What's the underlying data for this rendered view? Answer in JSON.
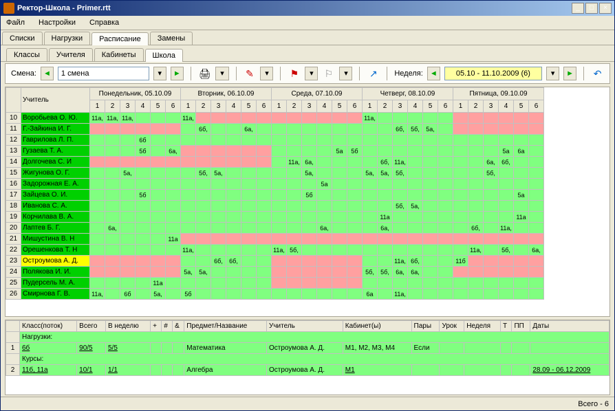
{
  "window": {
    "title": "Ректор-Школа - Primer.rtt"
  },
  "menu": [
    "Файл",
    "Настройки",
    "Справка"
  ],
  "tabs_main": [
    "Списки",
    "Нагрузки",
    "Расписание",
    "Замены"
  ],
  "tabs_main_active": 2,
  "tabs_sub": [
    "Классы",
    "Учителя",
    "Кабинеты",
    "Школа"
  ],
  "tabs_sub_active": 3,
  "toolbar": {
    "shift_label": "Смена:",
    "shift_value": "1 смена",
    "week_label": "Неделя:",
    "week_value": "05.10 - 11.10.2009  (6)"
  },
  "days": [
    "Понедельник, 05.10.09",
    "Вторник, 06.10.09",
    "Среда, 07.10.09",
    "Четверг, 08.10.09",
    "Пятница, 09.10.09"
  ],
  "periods": [
    "1",
    "2",
    "3",
    "4",
    "5",
    "6"
  ],
  "teacher_header": "Учитель",
  "rows": [
    {
      "n": "10",
      "name": "Воробьева О. Ю.",
      "tc": "teacher-grn",
      "cells": [
        "11а,",
        "11а,",
        "11а,",
        "",
        "",
        "",
        "11а,",
        "",
        "",
        "",
        "",
        "",
        "",
        "",
        "",
        "",
        "",
        "",
        "11а,",
        "",
        "",
        "",
        "",
        "",
        "",
        "",
        "",
        "",
        "",
        ""
      ]
    },
    {
      "n": "11",
      "name": "Г.-Зайкина И. Г.",
      "tc": "teacher-grn",
      "cells": [
        "",
        "",
        "",
        "",
        "",
        "",
        "",
        "6б,",
        "",
        "",
        "6а,",
        "",
        "",
        "",
        "",
        "",
        "",
        "",
        "",
        "",
        "6б,",
        "5б,",
        "5а,",
        "",
        "",
        "",
        "",
        "",
        "",
        ""
      ]
    },
    {
      "n": "12",
      "name": "Гаврилова Л. П.",
      "tc": "teacher-grn",
      "cells": [
        "",
        "",
        "",
        "6б",
        "",
        "",
        "",
        "",
        "",
        "",
        "",
        "",
        "",
        "",
        "",
        "",
        "",
        "",
        "",
        "",
        "",
        "",
        "",
        "",
        "",
        "",
        "",
        "",
        "",
        ""
      ]
    },
    {
      "n": "13",
      "name": "Гузаева Т. А.",
      "tc": "teacher-grn",
      "cells": [
        "",
        "",
        "",
        "5б",
        "",
        "6а,",
        "",
        "",
        "",
        "",
        "",
        "",
        "",
        "",
        "",
        "",
        "5а",
        "5б",
        "",
        "",
        "",
        "",
        "",
        "",
        "",
        "",
        "",
        "5а",
        "6а",
        ""
      ]
    },
    {
      "n": "14",
      "name": "Долгочева С. И",
      "tc": "teacher-grn",
      "cells": [
        "",
        "",
        "",
        "",
        "",
        "",
        "",
        "",
        "",
        "",
        "",
        "",
        "",
        "11а,",
        "6а,",
        "",
        "",
        "",
        "",
        "6б,",
        "11а,",
        "",
        "",
        "",
        "",
        "",
        "6а,",
        "6б,",
        "",
        ""
      ]
    },
    {
      "n": "15",
      "name": "Жигунова О. Г.",
      "tc": "teacher-grn",
      "cells": [
        "",
        "",
        "5а,",
        "",
        "",
        "",
        "",
        "5б,",
        "5а,",
        "",
        "",
        "",
        "",
        "",
        "5а,",
        "",
        "",
        "",
        "5а,",
        "5а,",
        "5б,",
        "",
        "",
        "",
        "",
        "",
        "5б,",
        "",
        "",
        ""
      ]
    },
    {
      "n": "16",
      "name": "Задорожная Е. А.",
      "tc": "teacher-grn",
      "cells": [
        "",
        "",
        "",
        "",
        "",
        "",
        "",
        "",
        "",
        "",
        "",
        "",
        "",
        "",
        "",
        "5а",
        "",
        "",
        "",
        "",
        "",
        "",
        "",
        "",
        "",
        "",
        "",
        "",
        "",
        ""
      ]
    },
    {
      "n": "17",
      "name": "Зайцева О. И.",
      "tc": "teacher-grn",
      "cells": [
        "",
        "",
        "",
        "5б",
        "",
        "",
        "",
        "",
        "",
        "",
        "",
        "",
        "",
        "",
        "5б",
        "",
        "",
        "",
        "",
        "",
        "",
        "",
        "",
        "",
        "",
        "",
        "",
        "",
        "5а",
        ""
      ]
    },
    {
      "n": "18",
      "name": "Иванова С. А.",
      "tc": "teacher-grn",
      "cells": [
        "",
        "",
        "",
        "",
        "",
        "",
        "",
        "",
        "",
        "",
        "",
        "",
        "",
        "",
        "",
        "",
        "",
        "",
        "",
        "",
        "5б,",
        "5а,",
        "",
        "",
        "",
        "",
        "",
        "",
        "",
        ""
      ]
    },
    {
      "n": "19",
      "name": "Корчилава В. А.",
      "tc": "teacher-grn",
      "cells": [
        "",
        "",
        "",
        "",
        "",
        "",
        "",
        "",
        "",
        "",
        "",
        "",
        "",
        "",
        "",
        "",
        "",
        "",
        "",
        "11а",
        "",
        "",
        "",
        "",
        "",
        "",
        "",
        "",
        "11а",
        ""
      ]
    },
    {
      "n": "20",
      "name": "Лаптев Б. Г.",
      "tc": "teacher-grn",
      "cells": [
        "",
        "6а,",
        "",
        "",
        "",
        "",
        "",
        "",
        "",
        "",
        "",
        "",
        "",
        "",
        "",
        "6а,",
        "",
        "",
        "",
        "6а,",
        "",
        "",
        "",
        "",
        "",
        "6б,",
        "",
        "11а,",
        "",
        ""
      ]
    },
    {
      "n": "21",
      "name": "Мишустина В. Н",
      "tc": "teacher-grn",
      "cells": [
        "",
        "",
        "",
        "",
        "",
        "11а",
        "",
        "",
        "",
        "",
        "",
        "",
        "",
        "",
        "",
        "",
        "",
        "",
        "",
        "",
        "",
        "",
        "",
        "",
        "",
        "",
        "",
        "",
        "",
        ""
      ]
    },
    {
      "n": "22",
      "name": "Орешенкова Т. Н",
      "tc": "teacher-grn",
      "cells": [
        "",
        "",
        "",
        "",
        "",
        "",
        "11а,",
        "",
        "",
        "",
        "",
        "",
        "11а,",
        "5б,",
        "",
        "",
        "",
        "",
        "",
        "",
        "",
        "",
        "",
        "",
        "",
        "11а,",
        "",
        "5б,",
        "",
        "6а,"
      ]
    },
    {
      "n": "23",
      "name": "Остроумова А. Д.",
      "tc": "teacher-yel",
      "cells": [
        "",
        "",
        "",
        "",
        "",
        "",
        "",
        "",
        "6б,",
        "6б,",
        "",
        "",
        "",
        "",
        "",
        "",
        "",
        "",
        "",
        "",
        "11а,",
        "6б,",
        "",
        "",
        "11б",
        "",
        "",
        "",
        "",
        ""
      ]
    },
    {
      "n": "24",
      "name": "Полякова И. И.",
      "tc": "teacher-grn",
      "cells": [
        "",
        "",
        "",
        "",
        "",
        "",
        "5а,",
        "5а,",
        "",
        "",
        "",
        "",
        "",
        "",
        "",
        "",
        "",
        "",
        "5б,",
        "5б,",
        "6а,",
        "6а,",
        "",
        "",
        "",
        "",
        "",
        "",
        "",
        ""
      ]
    },
    {
      "n": "25",
      "name": "Пудерсель М. А.",
      "tc": "teacher-grn",
      "cells": [
        "",
        "",
        "",
        "",
        "11а",
        "",
        "",
        "",
        "",
        "",
        "",
        "",
        "",
        "",
        "",
        "",
        "",
        "",
        "",
        "",
        "",
        "",
        "",
        "",
        "",
        "",
        "",
        "",
        "",
        ""
      ]
    },
    {
      "n": "26",
      "name": "Смирнова Г. В.",
      "tc": "teacher-grn",
      "cells": [
        "11а,",
        "",
        "6б",
        "",
        "5а,",
        "",
        "5б",
        "",
        "",
        "",
        "",
        "",
        "",
        "",
        "",
        "",
        "",
        "",
        "6а",
        "",
        "11а,",
        "",
        "",
        "",
        "",
        "",
        "",
        "",
        "",
        ""
      ]
    }
  ],
  "pink_map": {
    "10": [
      6,
      7,
      8,
      9,
      10,
      11,
      12,
      13,
      14,
      15,
      16,
      17,
      24,
      25,
      26,
      27,
      28,
      29
    ],
    "11": [
      0,
      1,
      2,
      3,
      4,
      5,
      24,
      25,
      26,
      27,
      28,
      29
    ],
    "13": [
      6,
      7,
      8,
      9,
      10,
      11
    ],
    "14": [
      0,
      1,
      2,
      3,
      4,
      5,
      6,
      7,
      8,
      9,
      10,
      11
    ],
    "21": [
      6,
      7,
      8,
      9,
      10,
      11,
      12,
      13,
      14,
      15,
      16,
      17,
      18,
      19,
      20,
      21,
      22,
      23,
      24,
      25,
      26,
      27,
      28,
      29
    ],
    "23": [
      0,
      1,
      2,
      3,
      4,
      5,
      12,
      13,
      14,
      15,
      16,
      17,
      25,
      26,
      27,
      28,
      29
    ],
    "24": [
      0,
      1,
      2,
      3,
      4,
      5,
      12,
      13,
      14,
      15,
      16,
      17,
      24,
      25,
      26,
      27,
      28,
      29
    ],
    "25": [
      12,
      13,
      14,
      15,
      16,
      17
    ]
  },
  "detail": {
    "headers": [
      "",
      "Класс(поток)",
      "Всего",
      "В неделю",
      "+",
      "#",
      "&",
      "Предмет/Название",
      "Учитель",
      "Кабинет(ы)",
      "Пары",
      "Урок",
      "Неделя",
      "Т",
      "ПП",
      "Даты"
    ],
    "group1": "Нагрузки:",
    "row1": [
      "1",
      "6б",
      "90/5",
      "5/5",
      "",
      "",
      "",
      "Математика",
      "Остроумова А. Д.",
      "М1, М2, М3, М4",
      "Если",
      "",
      "",
      "",
      "",
      ""
    ],
    "group2": "Курсы:",
    "row2": [
      "2",
      "11б, 11а",
      "10/1",
      "1/1",
      "",
      "",
      "",
      "Алгебра",
      "Остроумова А. Д.",
      "М1",
      "",
      "",
      "",
      "",
      "",
      "28.09 - 06.12.2009"
    ]
  },
  "status": "Всего - 6"
}
